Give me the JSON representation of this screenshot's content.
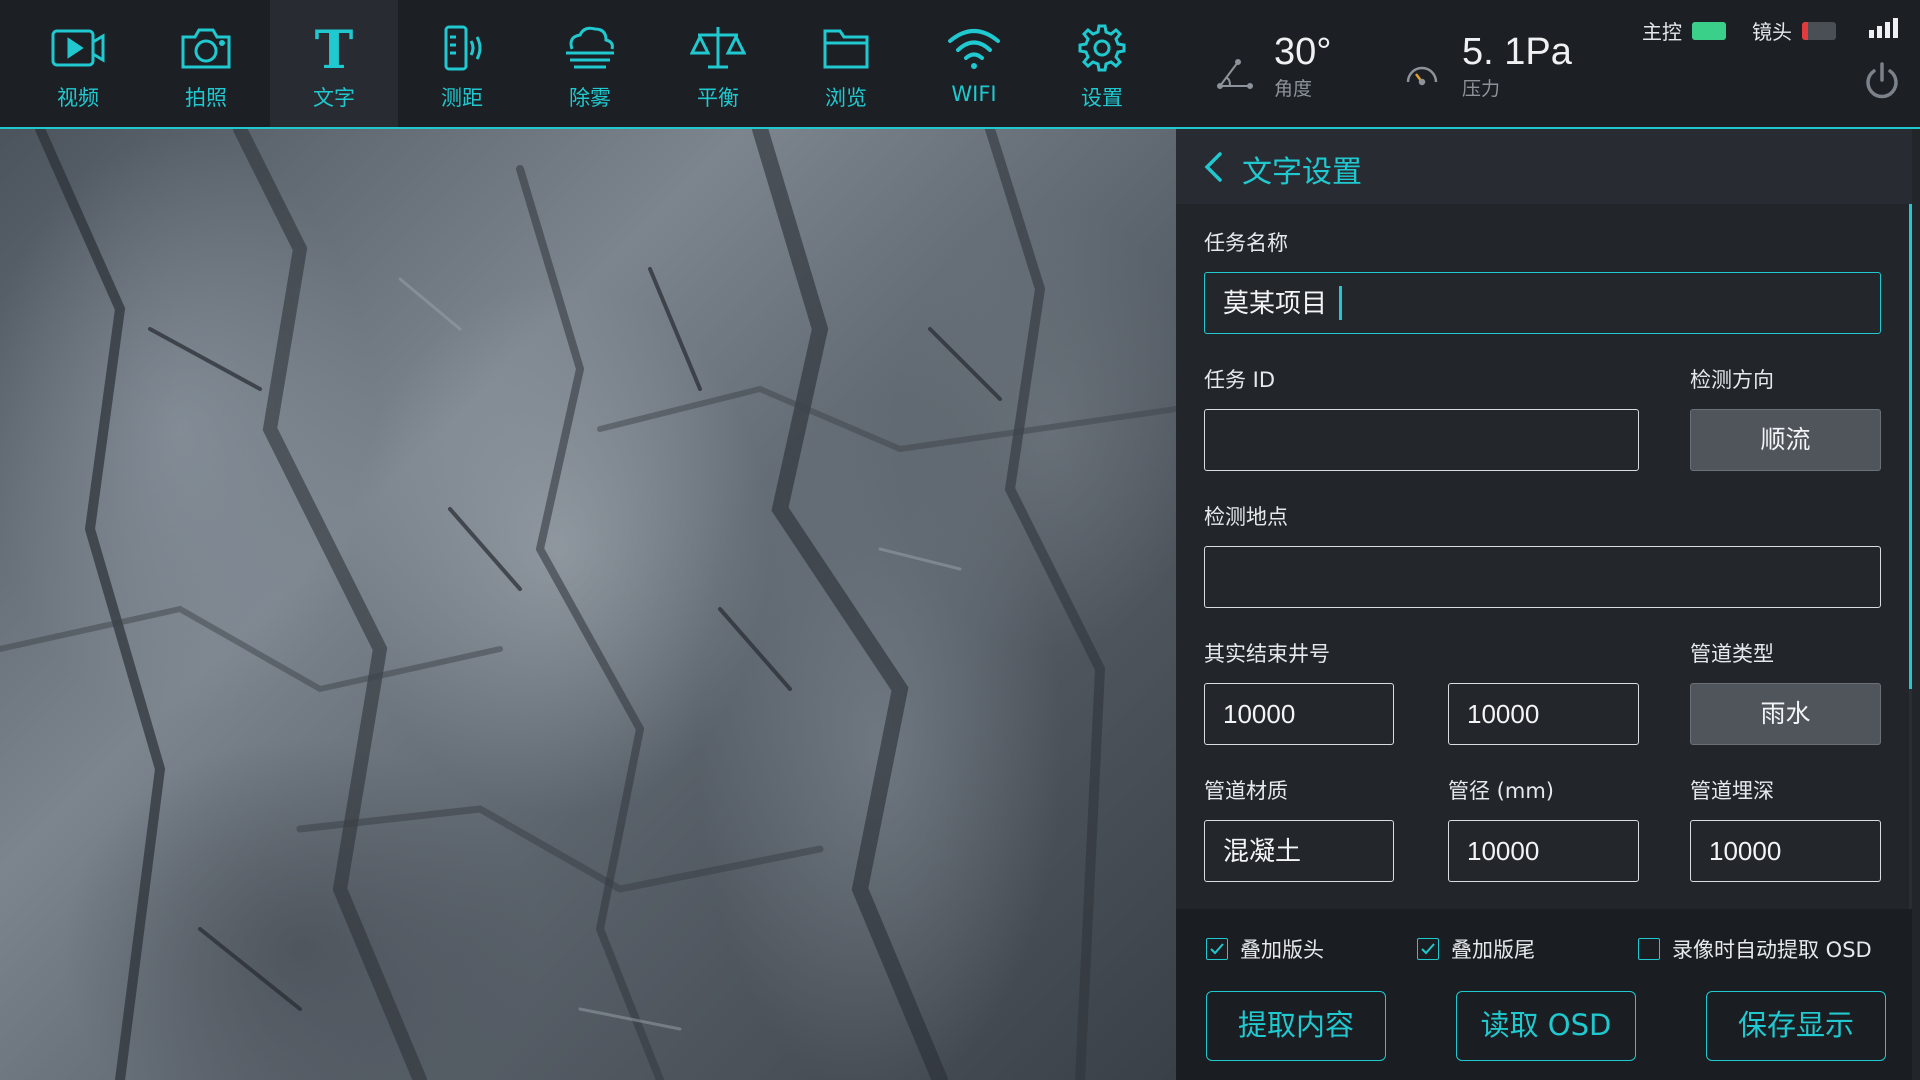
{
  "nav": [
    {
      "label": "视频",
      "icon": "video-icon",
      "active": false
    },
    {
      "label": "拍照",
      "icon": "camera-icon",
      "active": false
    },
    {
      "label": "文字",
      "icon": "text-icon",
      "active": true
    },
    {
      "label": "测距",
      "icon": "rangefinder-icon",
      "active": false
    },
    {
      "label": "除雾",
      "icon": "defog-icon",
      "active": false
    },
    {
      "label": "平衡",
      "icon": "balance-icon",
      "active": false
    },
    {
      "label": "浏览",
      "icon": "folder-icon",
      "active": false
    },
    {
      "label": "WIFI",
      "icon": "wifi-icon",
      "active": false
    },
    {
      "label": "设置",
      "icon": "gear-icon",
      "active": false
    }
  ],
  "readouts": {
    "angle": {
      "value": "30°",
      "caption": "角度"
    },
    "pressure": {
      "value": "5. 1Pa",
      "caption": "压力"
    }
  },
  "status": {
    "main_label": "主控",
    "main_battery_level": 1.0,
    "main_battery_color": "#3ad08a",
    "lens_label": "镜头",
    "lens_battery_level": 0.18,
    "lens_battery_color": "#e23b3b",
    "signal_bars": 4
  },
  "panel": {
    "title": "文字设置",
    "task_name": {
      "label": "任务名称",
      "value": "莫某项目"
    },
    "task_id": {
      "label": "任务 ID",
      "value": ""
    },
    "direction": {
      "label": "检测方向",
      "value": "顺流"
    },
    "location": {
      "label": "检测地点",
      "value": ""
    },
    "well_numbers": {
      "label": "其实结束井号",
      "start": "10000",
      "end": "10000"
    },
    "pipe_type": {
      "label": "管道类型",
      "value": "雨水"
    },
    "pipe_material": {
      "label": "管道材质",
      "value": "混凝土"
    },
    "pipe_diameter": {
      "label": "管径 (mm)",
      "value": "10000"
    },
    "pipe_depth": {
      "label": "管道埋深",
      "value": "10000"
    }
  },
  "options": [
    {
      "label": "叠加版头",
      "checked": true
    },
    {
      "label": "叠加版尾",
      "checked": true
    },
    {
      "label": "录像时自动提取 OSD",
      "checked": false
    }
  ],
  "actions": {
    "extract": "提取内容",
    "read_osd": "读取 OSD",
    "save": "保存显示"
  },
  "colors": {
    "accent": "#1fc9cf",
    "bar_bg": "#1c1f24",
    "panel_bg": "#22262b"
  }
}
